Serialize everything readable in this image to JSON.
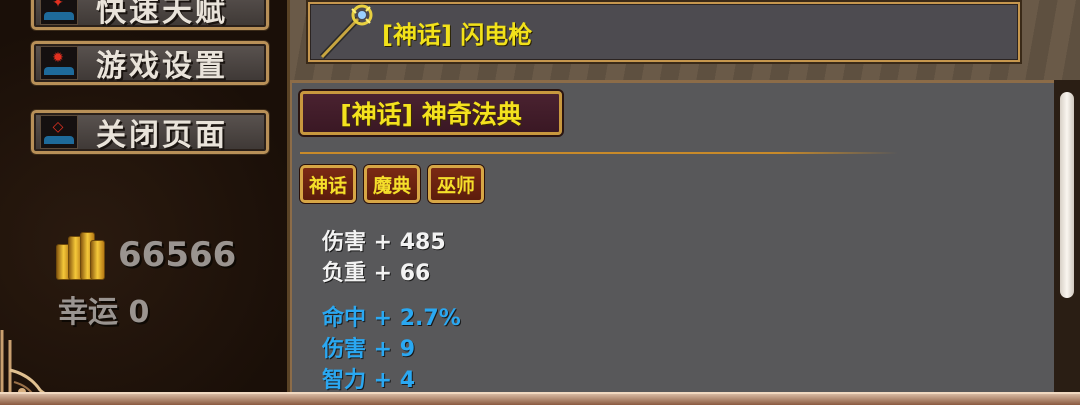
{
  "menu": {
    "items": [
      {
        "label": "快速天赋",
        "icon": "skill-book-icon"
      },
      {
        "label": "游戏设置",
        "icon": "settings-gear-icon"
      },
      {
        "label": "关闭页面",
        "icon": "close-page-icon"
      }
    ]
  },
  "status": {
    "gold": "66566",
    "luck": "幸运 0",
    "gold_icon": "gold-coins-icon"
  },
  "equipped_weapon": {
    "name": "[神话] 闪电枪",
    "icon": "lightning-staff-icon",
    "name_color": "#f2e21a"
  },
  "item_detail": {
    "title": "[神话] 神奇法典",
    "tags": [
      "神话",
      "魔典",
      "巫师"
    ],
    "base_stats": [
      "伤害 + 485",
      "负重 + 66"
    ],
    "bonus_stats": [
      "命中 + 2.7%",
      "伤害 + 9",
      "智力 + 4"
    ],
    "colors": {
      "base_stat": "#f2f2f2",
      "bonus_stat": "#2aa8f2",
      "title": "#f4e21e"
    }
  }
}
